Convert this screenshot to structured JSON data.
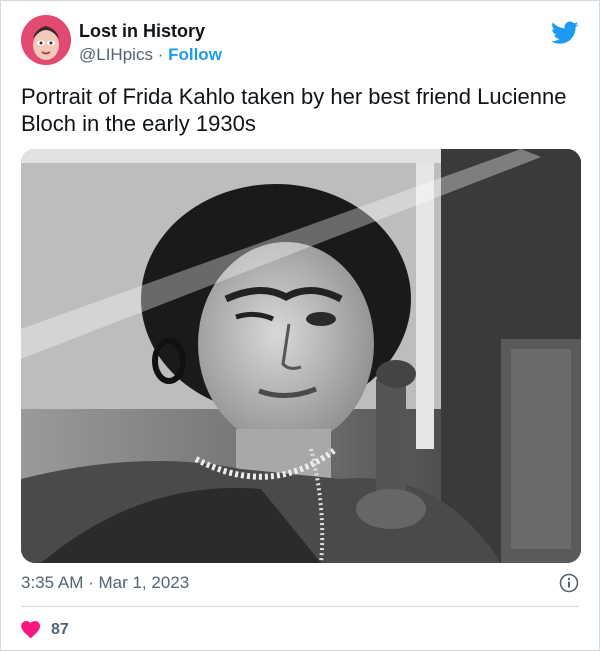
{
  "author": {
    "name": "Lost in History",
    "handle": "@LIHpics",
    "separator": "·",
    "follow_label": "Follow"
  },
  "tweet": {
    "text": "Portrait of Frida Kahlo taken by her best friend Lucienne Bloch in the early 1930s",
    "timestamp": "3:35 AM · Mar 1, 2023",
    "like_count": "87"
  },
  "icons": {
    "brand": "twitter-bird-icon",
    "info": "info-icon",
    "like": "heart-icon"
  },
  "colors": {
    "accent": "#1d9bf0",
    "like": "#f91880",
    "muted": "#536471",
    "avatar_bg": "#e24a72"
  }
}
